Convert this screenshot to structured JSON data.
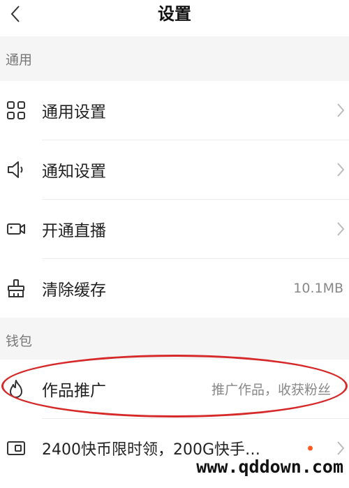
{
  "header": {
    "title": "设置",
    "back_icon": "chevron-left-icon"
  },
  "sections": {
    "general": "通用",
    "wallet": "钱包"
  },
  "general_items": [
    {
      "label": "通用设置",
      "icon": "grid-icon"
    },
    {
      "label": "通知设置",
      "icon": "speaker-icon"
    },
    {
      "label": "开通直播",
      "icon": "video-camera-icon"
    },
    {
      "label": "清除缓存",
      "icon": "broom-icon",
      "value": "10.1MB"
    }
  ],
  "wallet_items": [
    {
      "label": "作品推广",
      "icon": "flame-icon",
      "hint": "推广作品，收获粉丝"
    },
    {
      "label": "2400快币限时领，200G快手…",
      "icon": "card-icon"
    }
  ],
  "watermark": "www.qddown.com",
  "colors": {
    "highlight_oval": "#d62a2a",
    "badge_dot": "#ff5a1f"
  }
}
